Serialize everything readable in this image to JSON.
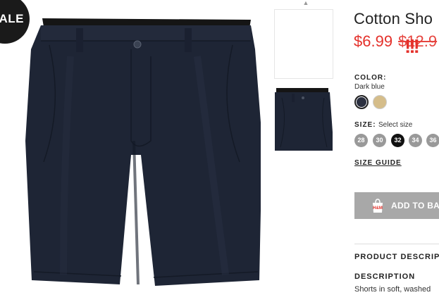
{
  "badge": {
    "text": "ALE"
  },
  "product": {
    "title": "Cotton Sho",
    "price_sale": "$6.99",
    "price_old": "$12.9",
    "marks": "!!!"
  },
  "color": {
    "label": "COLOR:",
    "value": "Dark blue",
    "swatches": [
      "#2b3040",
      "#d5bd8a"
    ]
  },
  "size": {
    "label": "SIZE:",
    "hint": "Select size",
    "options": [
      "28",
      "30",
      "32",
      "34",
      "36"
    ],
    "selected": "32"
  },
  "size_guide": "SIZE GUIDE",
  "add_to_bag": "ADD TO BAG",
  "bag_logo": "H&M",
  "product_description_header": "PRODUCT DESCRIPT",
  "description": {
    "label": "DESCRIPTION",
    "text": "Shorts in soft, washed"
  },
  "colors": {
    "sale_red": "#e4312b",
    "shorts": "#1e2535",
    "button": "#a8a8a8"
  }
}
